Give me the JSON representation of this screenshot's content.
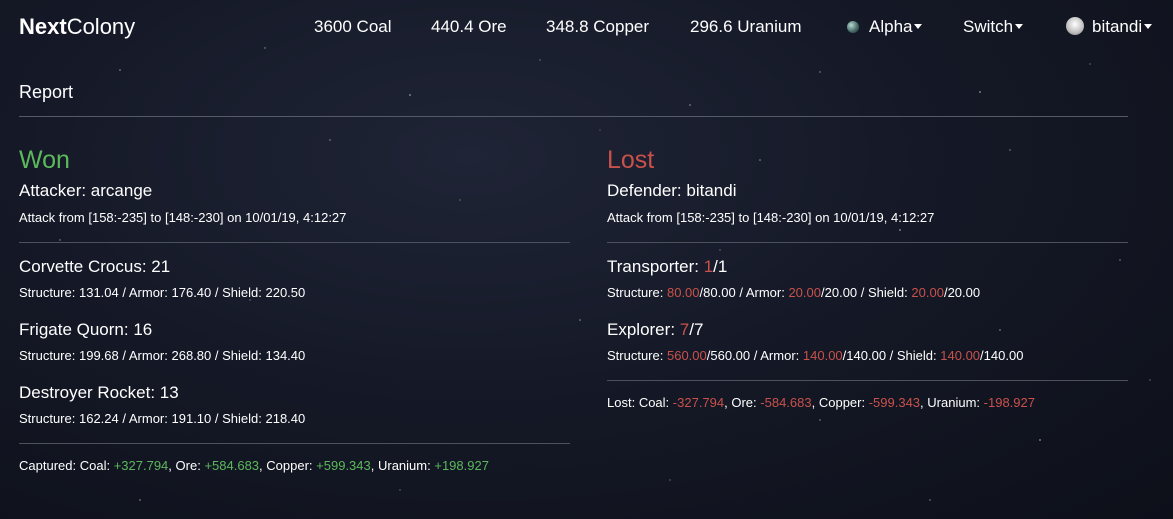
{
  "brand": {
    "bold": "Next",
    "regular": "Colony"
  },
  "resources": [
    {
      "label": "3600 Coal"
    },
    {
      "label": "440.4 Ore"
    },
    {
      "label": "348.8 Copper"
    },
    {
      "label": "296.6 Uranium"
    }
  ],
  "planet_menu": {
    "label": "Alpha",
    "icon": "planet-icon"
  },
  "switch_menu": {
    "label": "Switch"
  },
  "user_menu": {
    "label": "bitandi",
    "icon": "avatar-icon"
  },
  "page": {
    "title": "Report"
  },
  "colors": {
    "won": "#5cb85c",
    "lost": "#c9514b",
    "positive": "#5cb85c",
    "negative": "#c9514b"
  },
  "attacker": {
    "result": "Won",
    "party": "Attacker: arcange",
    "attack_line": "Attack from [158:-235] to [148:-230] on 10/01/19, 4:12:27",
    "ships": [
      {
        "name": "Corvette Crocus",
        "count": "21",
        "structure": "131.04",
        "armor": "176.40",
        "shield": "220.50"
      },
      {
        "name": "Frigate Quorn",
        "count": "16",
        "structure": "199.68",
        "armor": "268.80",
        "shield": "134.40"
      },
      {
        "name": "Destroyer Rocket",
        "count": "13",
        "structure": "162.24",
        "armor": "191.10",
        "shield": "218.40"
      }
    ],
    "summary": {
      "prefix": "Captured:",
      "coal_label": "Coal:",
      "coal": "+327.794",
      "ore_label": "Ore:",
      "ore": "+584.683",
      "copper_label": "Copper:",
      "copper": "+599.343",
      "uranium_label": "Uranium:",
      "uranium": "+198.927"
    }
  },
  "defender": {
    "result": "Lost",
    "party": "Defender: bitandi",
    "attack_line": "Attack from [158:-235] to [148:-230] on 10/01/19, 4:12:27",
    "ships": [
      {
        "name": "Transporter",
        "remaining": "1",
        "total": "1",
        "structure": "80.00",
        "structure_max": "80.00",
        "armor": "20.00",
        "armor_max": "20.00",
        "shield": "20.00",
        "shield_max": "20.00"
      },
      {
        "name": "Explorer",
        "remaining": "7",
        "total": "7",
        "structure": "560.00",
        "structure_max": "560.00",
        "armor": "140.00",
        "armor_max": "140.00",
        "shield": "140.00",
        "shield_max": "140.00"
      }
    ],
    "summary": {
      "prefix": "Lost:",
      "coal_label": "Coal:",
      "coal": "-327.794",
      "ore_label": "Ore:",
      "ore": "-584.683",
      "copper_label": "Copper:",
      "copper": "-599.343",
      "uranium_label": "Uranium:",
      "uranium": "-198.927"
    }
  },
  "labels": {
    "structure": "Structure:",
    "armor": "Armor:",
    "shield": "Shield:"
  }
}
